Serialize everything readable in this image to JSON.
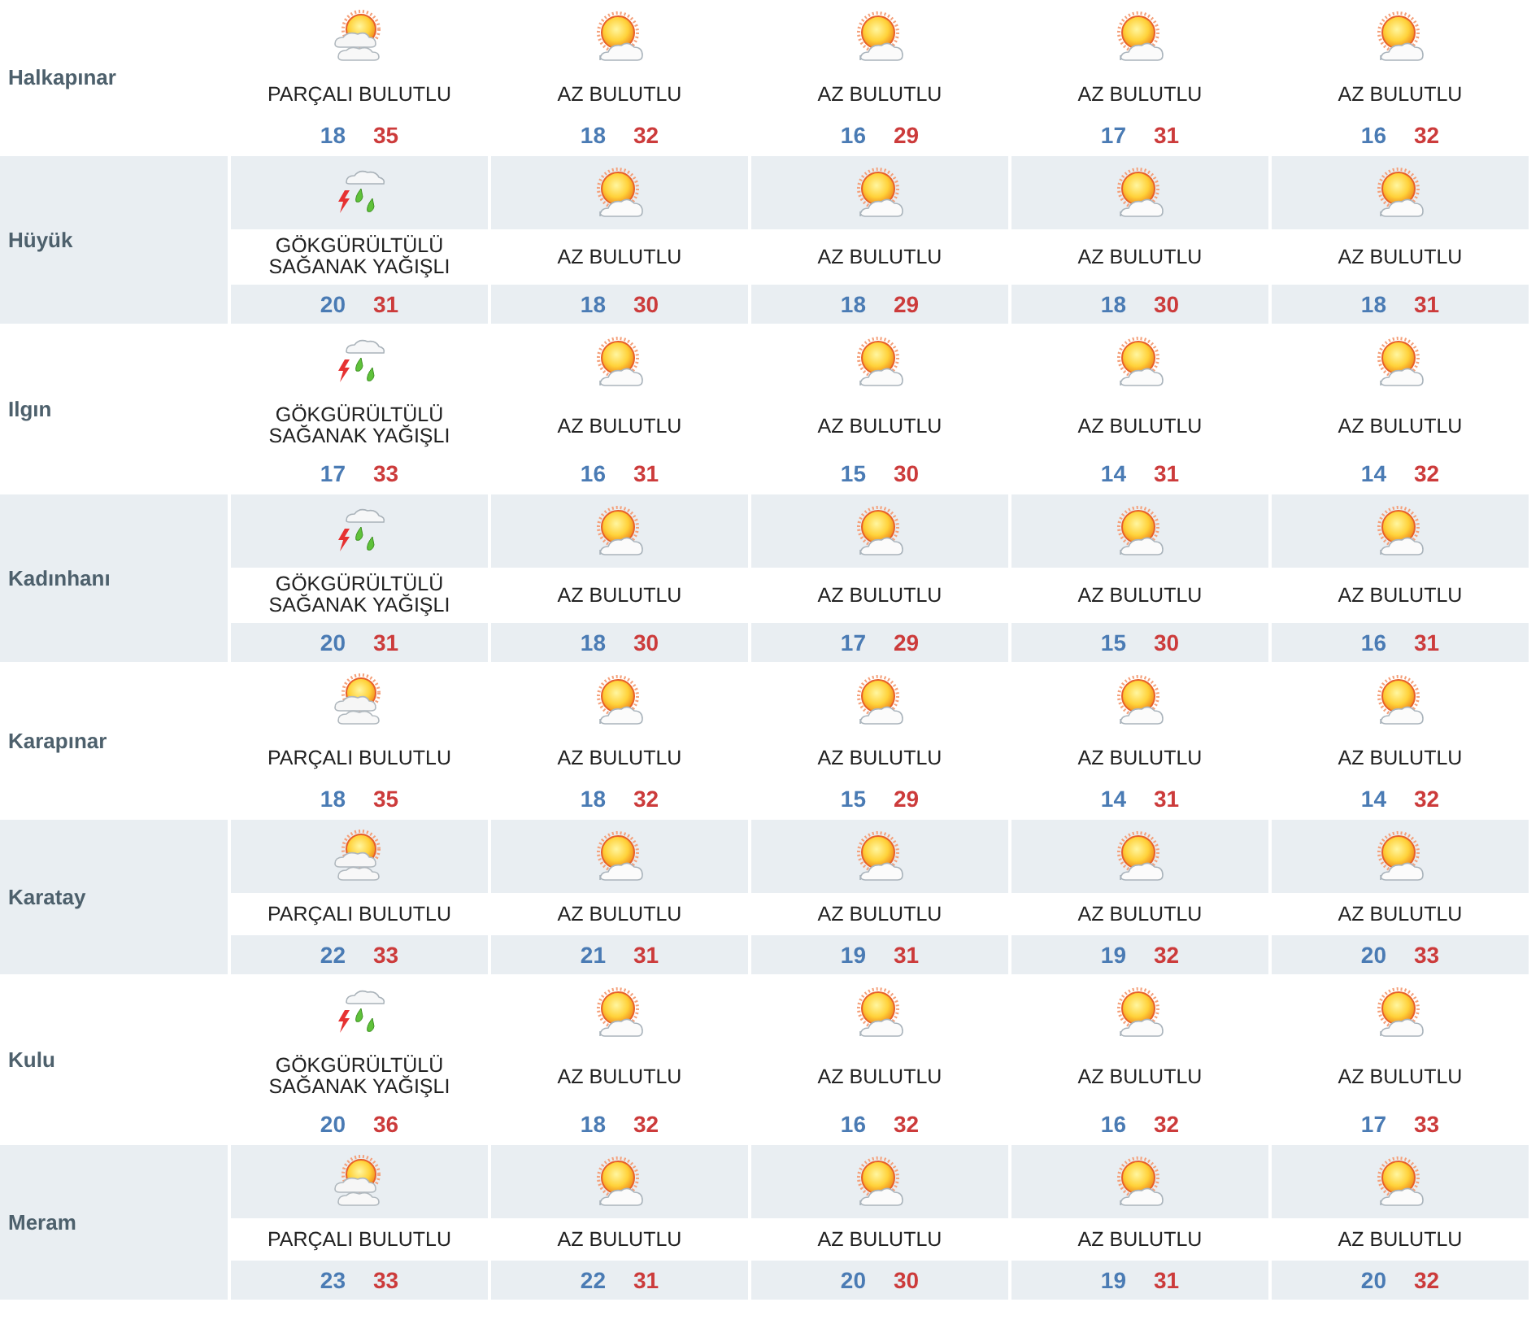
{
  "cities": [
    {
      "name": "Halkapınar",
      "days": [
        {
          "kind": "partly",
          "condition": "PARÇALI BULUTLU",
          "low": "18",
          "high": "35"
        },
        {
          "kind": "few",
          "condition": "AZ BULUTLU",
          "low": "18",
          "high": "32"
        },
        {
          "kind": "few",
          "condition": "AZ BULUTLU",
          "low": "16",
          "high": "29"
        },
        {
          "kind": "few",
          "condition": "AZ BULUTLU",
          "low": "17",
          "high": "31"
        },
        {
          "kind": "few",
          "condition": "AZ BULUTLU",
          "low": "16",
          "high": "32"
        }
      ]
    },
    {
      "name": "Hüyük",
      "days": [
        {
          "kind": "storm",
          "condition": "GÖKGÜRÜLTÜLÜ SAĞANAK YAĞIŞLI",
          "low": "20",
          "high": "31"
        },
        {
          "kind": "few",
          "condition": "AZ BULUTLU",
          "low": "18",
          "high": "30"
        },
        {
          "kind": "few",
          "condition": "AZ BULUTLU",
          "low": "18",
          "high": "29"
        },
        {
          "kind": "few",
          "condition": "AZ BULUTLU",
          "low": "18",
          "high": "30"
        },
        {
          "kind": "few",
          "condition": "AZ BULUTLU",
          "low": "18",
          "high": "31"
        }
      ]
    },
    {
      "name": "Ilgın",
      "days": [
        {
          "kind": "storm",
          "condition": "GÖKGÜRÜLTÜLÜ SAĞANAK YAĞIŞLI",
          "low": "17",
          "high": "33"
        },
        {
          "kind": "few",
          "condition": "AZ BULUTLU",
          "low": "16",
          "high": "31"
        },
        {
          "kind": "few",
          "condition": "AZ BULUTLU",
          "low": "15",
          "high": "30"
        },
        {
          "kind": "few",
          "condition": "AZ BULUTLU",
          "low": "14",
          "high": "31"
        },
        {
          "kind": "few",
          "condition": "AZ BULUTLU",
          "low": "14",
          "high": "32"
        }
      ]
    },
    {
      "name": "Kadınhanı",
      "days": [
        {
          "kind": "storm",
          "condition": "GÖKGÜRÜLTÜLÜ SAĞANAK YAĞIŞLI",
          "low": "20",
          "high": "31"
        },
        {
          "kind": "few",
          "condition": "AZ BULUTLU",
          "low": "18",
          "high": "30"
        },
        {
          "kind": "few",
          "condition": "AZ BULUTLU",
          "low": "17",
          "high": "29"
        },
        {
          "kind": "few",
          "condition": "AZ BULUTLU",
          "low": "15",
          "high": "30"
        },
        {
          "kind": "few",
          "condition": "AZ BULUTLU",
          "low": "16",
          "high": "31"
        }
      ]
    },
    {
      "name": "Karapınar",
      "days": [
        {
          "kind": "partly",
          "condition": "PARÇALI BULUTLU",
          "low": "18",
          "high": "35"
        },
        {
          "kind": "few",
          "condition": "AZ BULUTLU",
          "low": "18",
          "high": "32"
        },
        {
          "kind": "few",
          "condition": "AZ BULUTLU",
          "low": "15",
          "high": "29"
        },
        {
          "kind": "few",
          "condition": "AZ BULUTLU",
          "low": "14",
          "high": "31"
        },
        {
          "kind": "few",
          "condition": "AZ BULUTLU",
          "low": "14",
          "high": "32"
        }
      ]
    },
    {
      "name": "Karatay",
      "days": [
        {
          "kind": "partly",
          "condition": "PARÇALI BULUTLU",
          "low": "22",
          "high": "33"
        },
        {
          "kind": "few",
          "condition": "AZ BULUTLU",
          "low": "21",
          "high": "31"
        },
        {
          "kind": "few",
          "condition": "AZ BULUTLU",
          "low": "19",
          "high": "31"
        },
        {
          "kind": "few",
          "condition": "AZ BULUTLU",
          "low": "19",
          "high": "32"
        },
        {
          "kind": "few",
          "condition": "AZ BULUTLU",
          "low": "20",
          "high": "33"
        }
      ]
    },
    {
      "name": "Kulu",
      "days": [
        {
          "kind": "storm",
          "condition": "GÖKGÜRÜLTÜLÜ SAĞANAK YAĞIŞLI",
          "low": "20",
          "high": "36"
        },
        {
          "kind": "few",
          "condition": "AZ BULUTLU",
          "low": "18",
          "high": "32"
        },
        {
          "kind": "few",
          "condition": "AZ BULUTLU",
          "low": "16",
          "high": "32"
        },
        {
          "kind": "few",
          "condition": "AZ BULUTLU",
          "low": "16",
          "high": "32"
        },
        {
          "kind": "few",
          "condition": "AZ BULUTLU",
          "low": "17",
          "high": "33"
        }
      ]
    },
    {
      "name": "Meram",
      "days": [
        {
          "kind": "partly",
          "condition": "PARÇALI BULUTLU",
          "low": "23",
          "high": "33"
        },
        {
          "kind": "few",
          "condition": "AZ BULUTLU",
          "low": "22",
          "high": "31"
        },
        {
          "kind": "few",
          "condition": "AZ BULUTLU",
          "low": "20",
          "high": "30"
        },
        {
          "kind": "few",
          "condition": "AZ BULUTLU",
          "low": "19",
          "high": "31"
        },
        {
          "kind": "few",
          "condition": "AZ BULUTLU",
          "low": "20",
          "high": "32"
        }
      ]
    }
  ]
}
